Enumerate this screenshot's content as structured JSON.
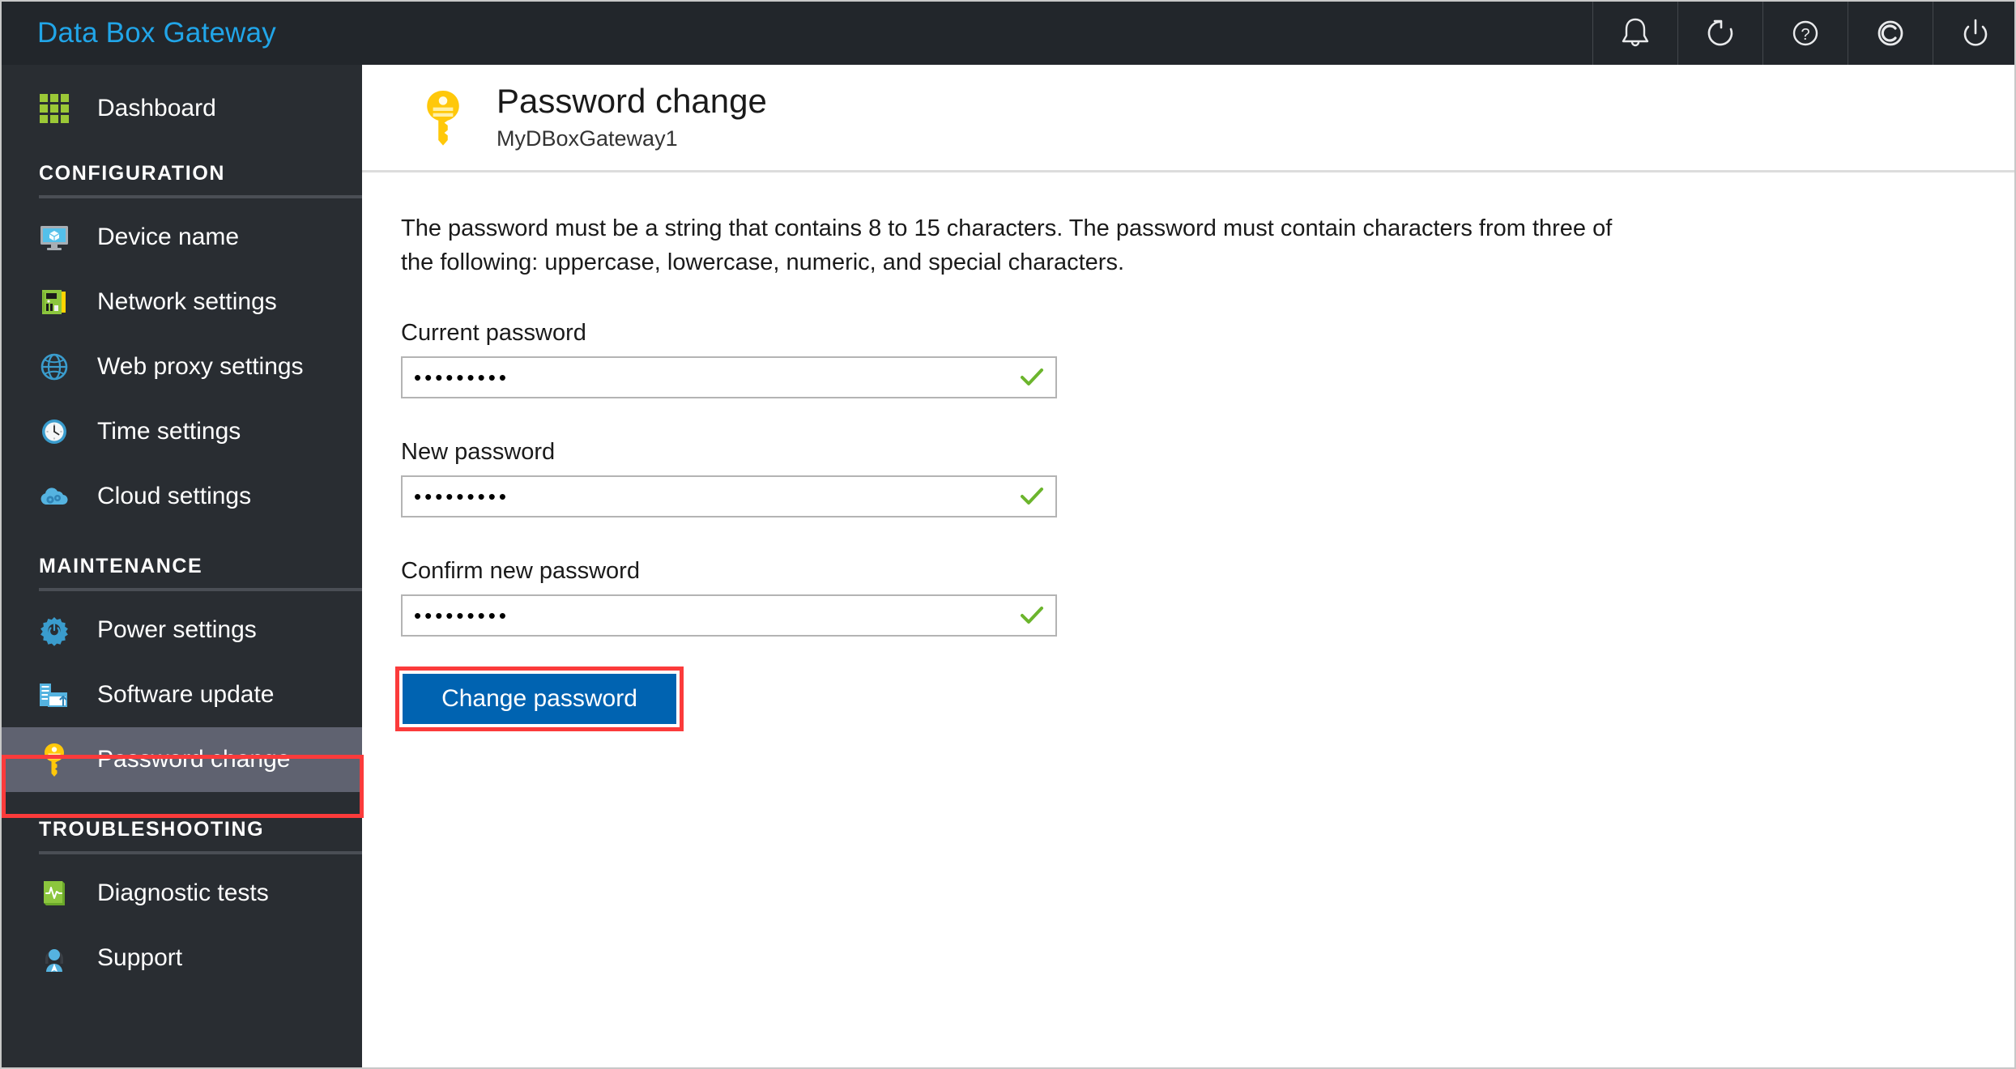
{
  "app": {
    "title": "Data Box Gateway",
    "accent_color": "#21a5e8",
    "titlebar_bg": "#22262b",
    "sidebar_bg": "#292d32",
    "selected_bg": "#5f6270",
    "annotation_color": "#fb3b3b",
    "button_color": "#0063b1",
    "check_color": "#6cb52d"
  },
  "titlebar": {
    "actions": [
      {
        "name": "alerts-icon",
        "label": "Alerts"
      },
      {
        "name": "refresh-icon",
        "label": "Refresh"
      },
      {
        "name": "help-icon",
        "label": "Help"
      },
      {
        "name": "copyright-icon",
        "label": "Copyright"
      },
      {
        "name": "power-icon",
        "label": "Power"
      }
    ]
  },
  "sidebar": {
    "top_item": {
      "label": "Dashboard",
      "icon": "dashboard-grid-icon",
      "selected": false
    },
    "sections": [
      {
        "title": "CONFIGURATION",
        "items": [
          {
            "label": "Device name",
            "icon": "monitor-icon",
            "selected": false
          },
          {
            "label": "Network settings",
            "icon": "network-card-icon",
            "selected": false
          },
          {
            "label": "Web proxy settings",
            "icon": "globe-icon",
            "selected": false
          },
          {
            "label": "Time settings",
            "icon": "clock-icon",
            "selected": false
          },
          {
            "label": "Cloud settings",
            "icon": "cloud-gear-icon",
            "selected": false
          }
        ]
      },
      {
        "title": "MAINTENANCE",
        "items": [
          {
            "label": "Power settings",
            "icon": "gear-power-icon",
            "selected": false
          },
          {
            "label": "Software update",
            "icon": "software-update-icon",
            "selected": false
          },
          {
            "label": "Password change",
            "icon": "key-icon",
            "selected": true
          }
        ]
      },
      {
        "title": "TROUBLESHOOTING",
        "items": [
          {
            "label": "Diagnostic tests",
            "icon": "diagnostics-book-icon",
            "selected": false
          },
          {
            "label": "Support",
            "icon": "support-person-icon",
            "selected": false
          }
        ]
      }
    ]
  },
  "page": {
    "icon": "key-icon",
    "title": "Password change",
    "subtitle": "MyDBoxGateway1",
    "description": "The password must be a string that contains 8 to 15 characters. The password must contain characters from three of the following: uppercase, lowercase, numeric, and special characters.",
    "fields": [
      {
        "label": "Current password",
        "value": "•••••••••",
        "placeholder": "",
        "valid": true
      },
      {
        "label": "New password",
        "value": "•••••••••",
        "placeholder": "",
        "valid": true
      },
      {
        "label": "Confirm new password",
        "value": "•••••••••",
        "placeholder": "",
        "valid": true
      }
    ],
    "submit_label": "Change password"
  }
}
